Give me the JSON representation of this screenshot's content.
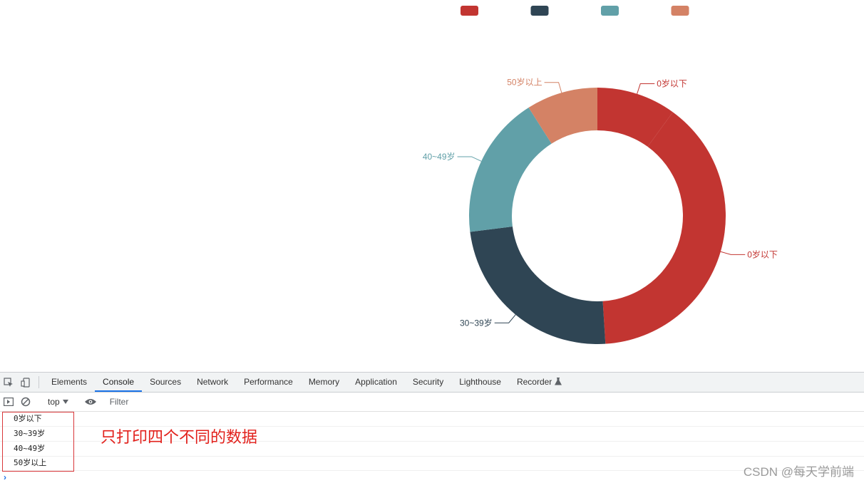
{
  "chart_data": {
    "type": "pie",
    "variant": "donut",
    "categories": [
      "0岁以下",
      "0岁以下",
      "30~39岁",
      "40~49岁",
      "50岁以上"
    ],
    "values": [
      10,
      39,
      24,
      18,
      9
    ],
    "colors": [
      "#c23531",
      "#c23531",
      "#2f4554",
      "#61a0a8",
      "#d48265"
    ],
    "legend": {
      "placement": "top-center",
      "colors": [
        "#c23531",
        "#2f4554",
        "#61a0a8",
        "#d48265"
      ]
    }
  },
  "devtools": {
    "tabs": [
      "Elements",
      "Console",
      "Sources",
      "Network",
      "Performance",
      "Memory",
      "Application",
      "Security",
      "Lighthouse",
      "Recorder"
    ],
    "active_tab": "Console",
    "context": "top",
    "filter_placeholder": "Filter",
    "console_lines": [
      "0岁以下",
      "30~39岁",
      "40~49岁",
      "50岁以上"
    ]
  },
  "annotation": "只打印四个不同的数据",
  "watermark": "CSDN @每天学前端"
}
